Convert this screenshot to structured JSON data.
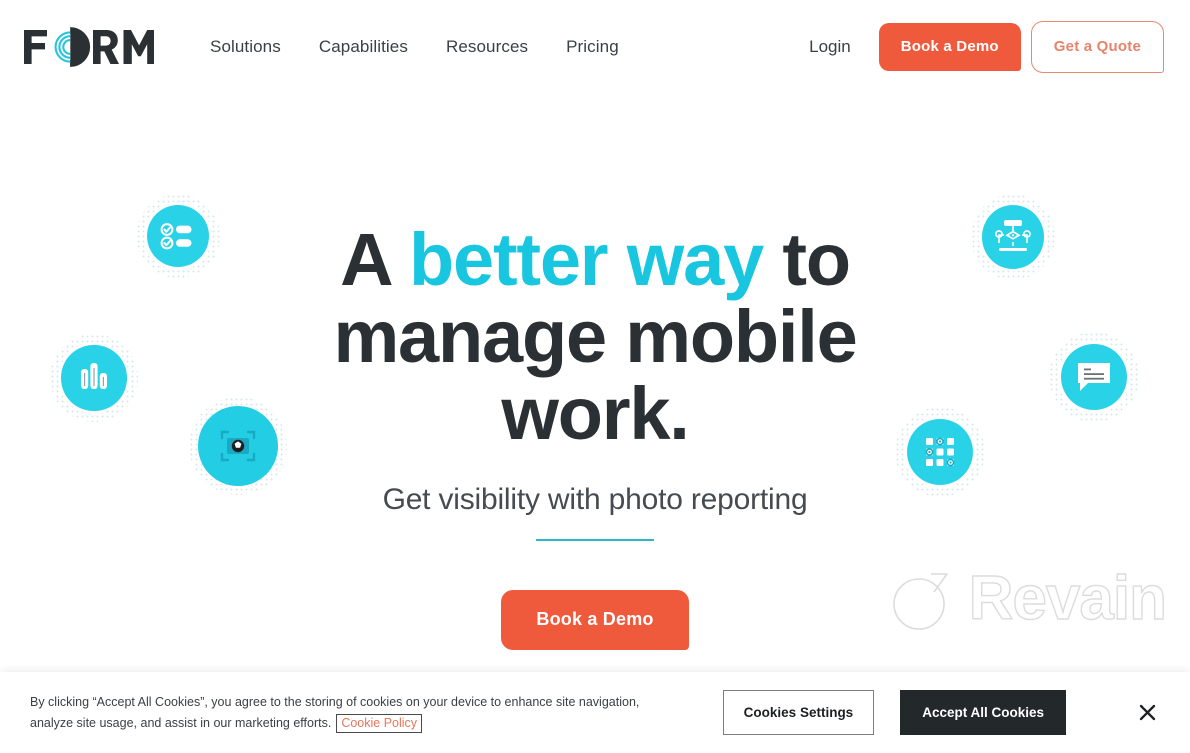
{
  "brand": {
    "logo_text": "FORM",
    "accent_cyan": "#2ad2e8",
    "accent_orange": "#f05a3c",
    "text_dark": "#2b3034"
  },
  "header": {
    "nav_items": [
      {
        "label": "Solutions"
      },
      {
        "label": "Capabilities"
      },
      {
        "label": "Resources"
      },
      {
        "label": "Pricing"
      }
    ],
    "login_label": "Login",
    "demo_button_label": "Book a Demo",
    "quote_button_label": "Get a Quote"
  },
  "hero": {
    "headline_part1": "A ",
    "headline_accent": "better way",
    "headline_part2": " to manage mobile work.",
    "subheadline": "Get visibility with photo reporting",
    "cta_label": "Book a Demo",
    "badges": [
      {
        "name": "checklist-icon",
        "label": "checklist"
      },
      {
        "name": "workflow-icon",
        "label": "workflow"
      },
      {
        "name": "bar-chart-icon",
        "label": "bar chart"
      },
      {
        "name": "chat-bubble-icon",
        "label": "chat bubble"
      },
      {
        "name": "camera-capture-icon",
        "label": "photo capture"
      },
      {
        "name": "dot-grid-icon",
        "label": "data grid"
      }
    ]
  },
  "watermark": {
    "text": "Revain"
  },
  "cookie_banner": {
    "body_text": "By clicking “Accept All Cookies”, you agree to the storing of cookies on your device to enhance site navigation, analyze site usage, and assist in our marketing efforts.",
    "policy_link_label": "Cookie Policy",
    "settings_button_label": "Cookies Settings",
    "accept_button_label": "Accept All Cookies",
    "close_label": "✕"
  }
}
